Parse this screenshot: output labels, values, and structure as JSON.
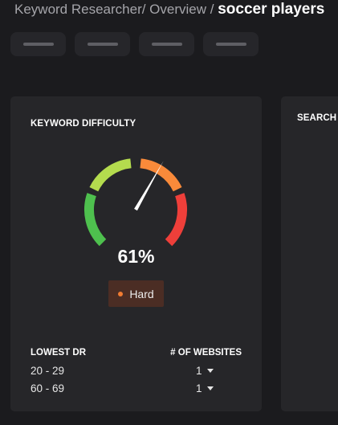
{
  "breadcrumb": {
    "path": "Keyword Researcher/ Overview / ",
    "current": "soccer players"
  },
  "tabs": [
    {
      "label": ""
    },
    {
      "label": ""
    },
    {
      "label": ""
    },
    {
      "label": ""
    }
  ],
  "difficulty_card": {
    "title": "KEYWORD DIFFICULTY",
    "value": 61,
    "value_label": "61%",
    "level": "Hard",
    "level_color": "#f27c32",
    "gauge_colors": [
      "#4ec04e",
      "#b4dc4e",
      "#f98a3a",
      "#ee3f3a"
    ],
    "table": {
      "col1_header": "LOWEST DR",
      "col2_header": "# OF WEBSITES",
      "rows": [
        {
          "dr": "20 - 29",
          "count": "1"
        },
        {
          "dr": "60 - 69",
          "count": "1"
        }
      ]
    }
  },
  "search_card": {
    "title": "SEARCH"
  }
}
